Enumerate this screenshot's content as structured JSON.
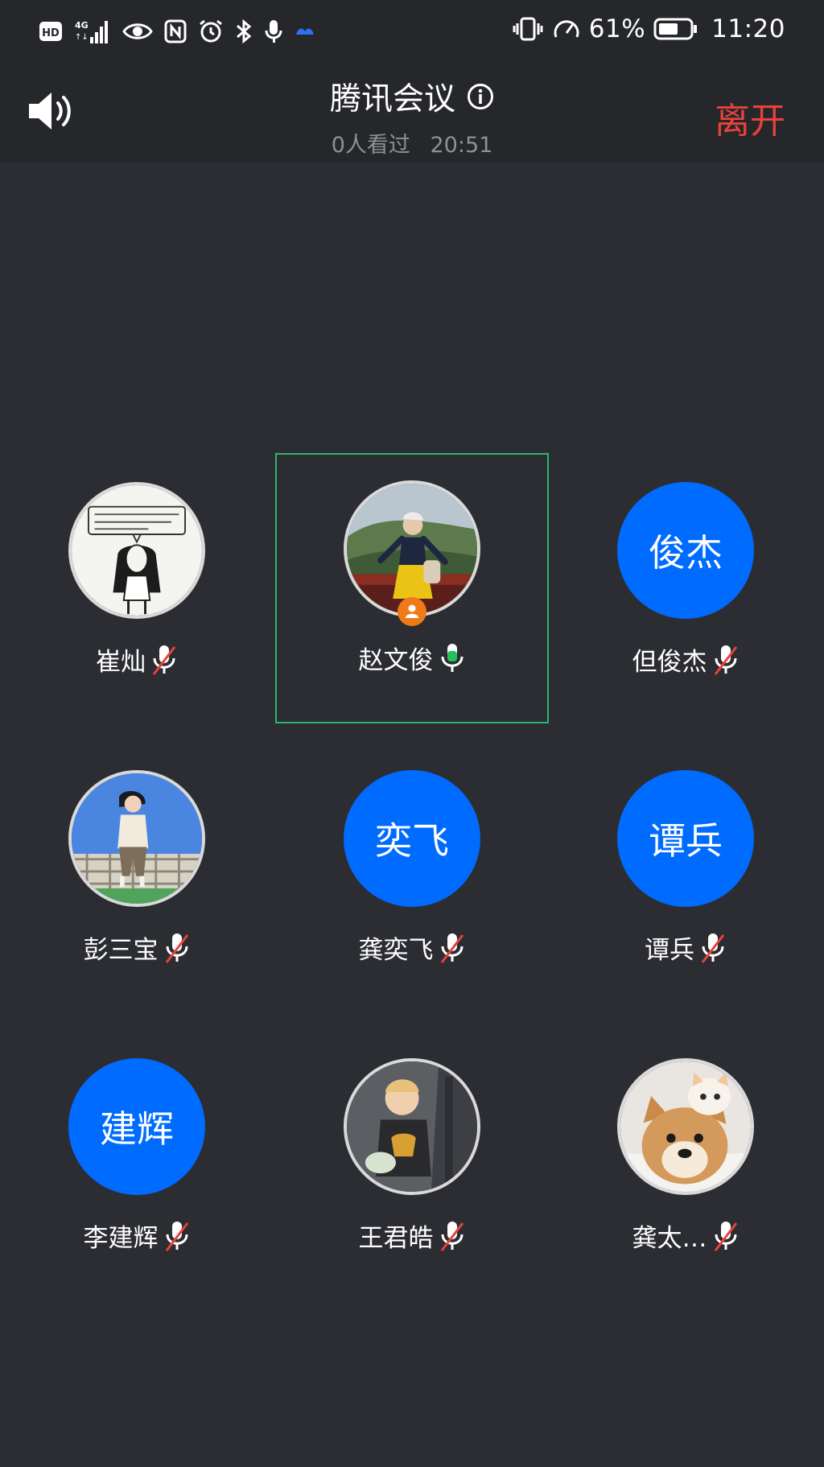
{
  "status_bar": {
    "left_icons": [
      "hd-icon",
      "signal-4g-icon",
      "eye-icon",
      "nfc-icon",
      "alarm-icon",
      "bluetooth-icon",
      "microphone-icon",
      "cloud-icon"
    ],
    "battery_percent": "61%",
    "time": "11:20",
    "right_icons": [
      "vibrate-icon",
      "speed-icon",
      "battery-icon"
    ]
  },
  "header": {
    "title": "腾讯会议",
    "viewers": "0人看过",
    "duration": "20:51",
    "leave_label": "离开"
  },
  "participants": [
    {
      "name": "崔灿",
      "avatar_type": "photo",
      "avatar_desc": "sketch-girl",
      "mic": "muted"
    },
    {
      "name": "赵文俊",
      "avatar_type": "photo",
      "avatar_desc": "landscape",
      "mic": "active",
      "host": true,
      "selected": true
    },
    {
      "name": "但俊杰",
      "avatar_type": "initials",
      "initials": "俊杰",
      "mic": "muted"
    },
    {
      "name": "彭三宝",
      "avatar_type": "photo",
      "avatar_desc": "illustration",
      "mic": "muted"
    },
    {
      "name": "龚奕飞",
      "avatar_type": "initials",
      "initials": "奕飞",
      "mic": "muted"
    },
    {
      "name": "谭兵",
      "avatar_type": "initials",
      "initials": "谭兵",
      "mic": "muted"
    },
    {
      "name": "李建辉",
      "avatar_type": "initials",
      "initials": "建辉",
      "mic": "muted"
    },
    {
      "name": "王君皓",
      "avatar_type": "photo",
      "avatar_desc": "child",
      "mic": "muted"
    },
    {
      "name": "龚太…",
      "avatar_type": "photo",
      "avatar_desc": "dog-cat",
      "mic": "muted"
    }
  ],
  "colors": {
    "background": "#2b2d33",
    "bar": "#25272b",
    "initials_avatar": "#006bff",
    "leave": "#e8423b",
    "mic_active": "#23c25a",
    "mic_muted_slash": "#e8423b",
    "selected_border": "#2fb46c",
    "host_badge": "#f07a18"
  }
}
